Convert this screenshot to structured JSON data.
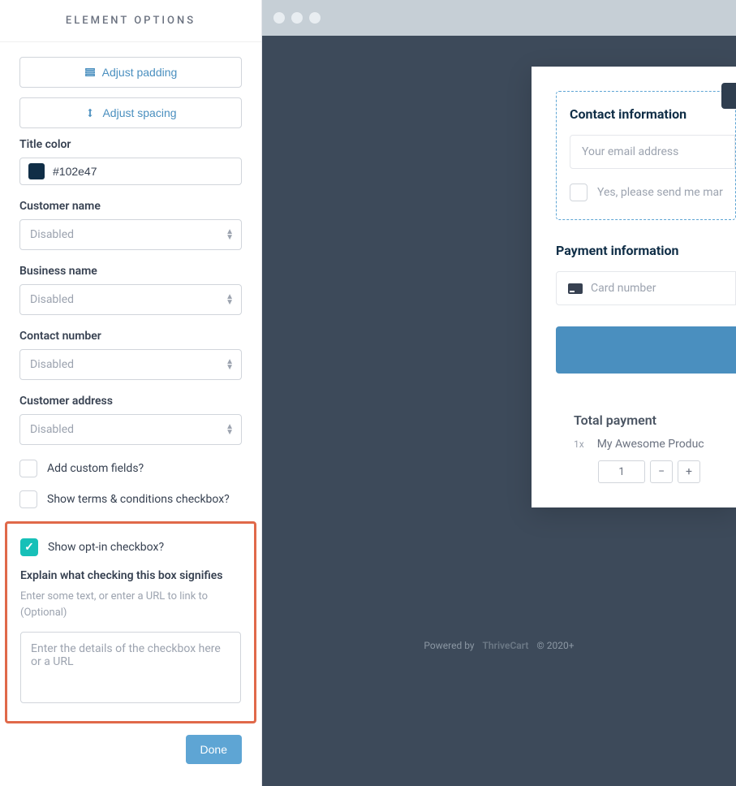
{
  "sidebar": {
    "header": "ELEMENT OPTIONS",
    "adjust_padding": "Adjust padding",
    "adjust_spacing": "Adjust spacing",
    "title_color_label": "Title color",
    "title_color_value": "#102e47",
    "customer_name_label": "Customer name",
    "customer_name_value": "Disabled",
    "business_name_label": "Business name",
    "business_name_value": "Disabled",
    "contact_number_label": "Contact number",
    "contact_number_value": "Disabled",
    "customer_address_label": "Customer address",
    "customer_address_value": "Disabled",
    "add_custom_fields": "Add custom fields?",
    "show_terms": "Show terms & conditions checkbox?",
    "show_optin": "Show opt-in checkbox?",
    "explain_label": "Explain what checking this box signifies",
    "explain_hint": "Enter some text, or enter a URL to link to (Optional)",
    "explain_placeholder": "Enter the details of the checkbox here or a URL",
    "done": "Done"
  },
  "preview": {
    "contact_title": "Contact information",
    "email_placeholder": "Your email address",
    "optin_text": "Yes, please send me mar",
    "payment_title": "Payment information",
    "card_placeholder": "Card number",
    "total_title": "Total payment",
    "qty_prefix": "1x",
    "product_name": "My Awesome Produc",
    "qty_value": "1",
    "minus": "−",
    "plus": "+",
    "powered_by": "Powered by",
    "brand": "ThriveCart",
    "copyright": "© 2020+"
  }
}
